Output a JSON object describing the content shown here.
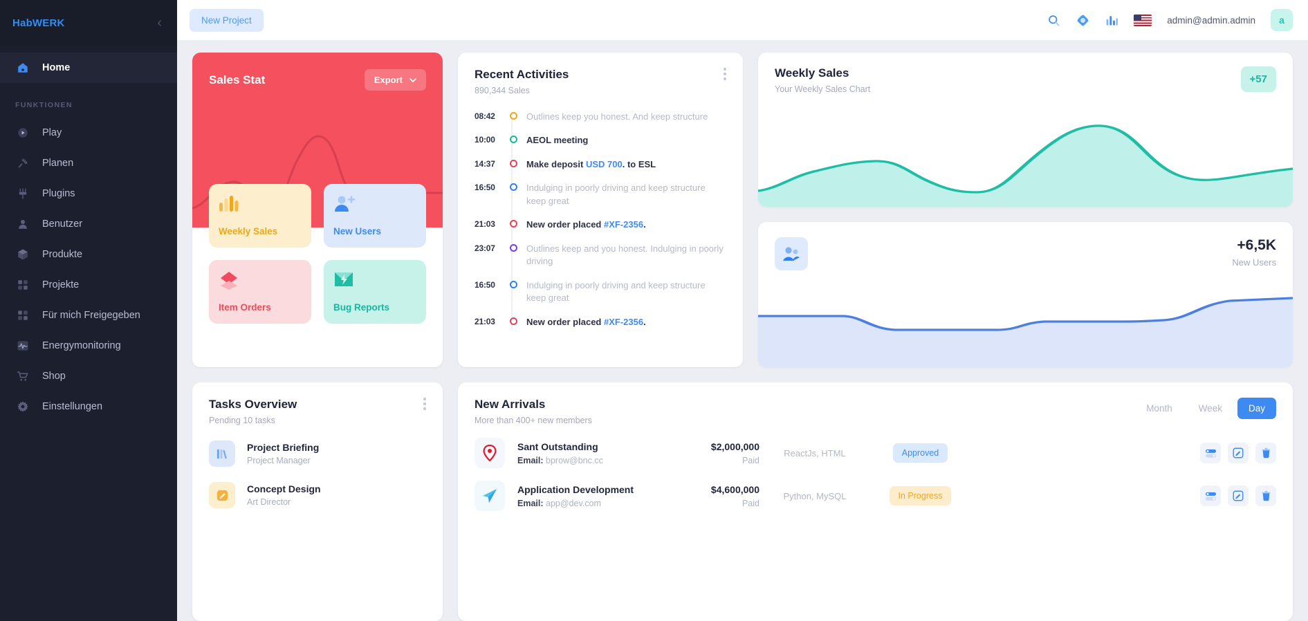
{
  "sidebar": {
    "logo": "HabWERK",
    "collapse_icon": "chevron-left-icon",
    "home": {
      "label": "Home",
      "icon": "home-icon"
    },
    "section_label": "FUNKTIONEN",
    "items": [
      {
        "label": "Play",
        "icon": "play-circle-icon"
      },
      {
        "label": "Planen",
        "icon": "tools-icon"
      },
      {
        "label": "Plugins",
        "icon": "plug-icon"
      },
      {
        "label": "Benutzer",
        "icon": "user-icon"
      },
      {
        "label": "Produkte",
        "icon": "box-icon"
      },
      {
        "label": "Projekte",
        "icon": "grid-icon"
      },
      {
        "label": "Für mich Freigegeben",
        "icon": "grid-icon"
      },
      {
        "label": "Energymonitoring",
        "icon": "pulse-icon"
      },
      {
        "label": "Shop",
        "icon": "cart-icon"
      },
      {
        "label": "Einstellungen",
        "icon": "gear-icon"
      }
    ]
  },
  "topbar": {
    "new_project": "New Project",
    "icons": [
      "search-icon",
      "diamond-icon",
      "bar-chart-icon",
      "flag-us-icon"
    ],
    "user_email": "admin@admin.admin",
    "avatar_letter": "a"
  },
  "sales_stat": {
    "title": "Sales Stat",
    "export_label": "Export",
    "export_icon": "chevron-down-icon",
    "tiles": [
      {
        "label": "Weekly Sales",
        "icon": "bar-chart-icon",
        "theme": "yellow"
      },
      {
        "label": "New Users",
        "icon": "user-plus-icon",
        "theme": "blue"
      },
      {
        "label": "Item Orders",
        "icon": "diamond-layers-icon",
        "theme": "pink"
      },
      {
        "label": "Bug Reports",
        "icon": "bug-mail-icon",
        "theme": "mint"
      }
    ]
  },
  "activities": {
    "title": "Recent Activities",
    "subtitle": "890,344 Sales",
    "menu_icon": "kebab-menu-icon",
    "items": [
      {
        "time": "08:42",
        "color": "#f0a718",
        "muted": true,
        "pre": "Outlines keep you honest. And keep structure",
        "hl": "",
        "post": ""
      },
      {
        "time": "10:00",
        "color": "#19b69e",
        "muted": false,
        "pre": "AEOL meeting",
        "hl": "",
        "post": ""
      },
      {
        "time": "14:37",
        "color": "#ee3d52",
        "muted": false,
        "pre": "Make deposit ",
        "hl": "USD 700",
        "post": ". to ESL"
      },
      {
        "time": "16:50",
        "color": "#2f80ed",
        "muted": true,
        "pre": "Indulging in poorly driving and keep structure keep great",
        "hl": "",
        "post": ""
      },
      {
        "time": "21:03",
        "color": "#ee3d52",
        "muted": false,
        "pre": "New order placed ",
        "hl": "#XF-2356",
        "post": "."
      },
      {
        "time": "23:07",
        "color": "#7c3aed",
        "muted": true,
        "pre": "Outlines keep and you honest. Indulging in poorly driving",
        "hl": "",
        "post": ""
      },
      {
        "time": "16:50",
        "color": "#2f80ed",
        "muted": true,
        "pre": "Indulging in poorly driving and keep structure keep great",
        "hl": "",
        "post": ""
      },
      {
        "time": "21:03",
        "color": "#ee3d52",
        "muted": false,
        "pre": "New order placed ",
        "hl": "#XF-2356",
        "post": "."
      }
    ]
  },
  "weekly_sales": {
    "title": "Weekly Sales",
    "subtitle": "Your Weekly Sales Chart",
    "badge": "+57"
  },
  "new_users": {
    "value": "+6,5K",
    "label": "New Users",
    "icon": "users-icon"
  },
  "tasks": {
    "title": "Tasks Overview",
    "subtitle": "Pending 10 tasks",
    "menu_icon": "kebab-menu-icon",
    "items": [
      {
        "name": "Project Briefing",
        "role": "Project Manager",
        "icon": "books-icon",
        "theme": "blue"
      },
      {
        "name": "Concept Design",
        "role": "Art Director",
        "icon": "pencil-square-icon",
        "theme": "yellow"
      }
    ]
  },
  "arrivals": {
    "title": "New Arrivals",
    "subtitle": "More than 400+ new members",
    "segments": [
      {
        "label": "Month",
        "active": false
      },
      {
        "label": "Week",
        "active": false
      },
      {
        "label": "Day",
        "active": true
      }
    ],
    "email_label": "Email:",
    "rows": [
      {
        "name": "Sant Outstanding",
        "email": "bprow@bnc.cc",
        "amount": "$2,000,000",
        "paid": "Paid",
        "tech": "ReactJs, HTML",
        "status": "Approved",
        "status_theme": "approved",
        "icon": "pin-p-icon",
        "icon_theme": "red",
        "actions": [
          "toggle-icon",
          "edit-icon",
          "delete-icon"
        ]
      },
      {
        "name": "Application Development",
        "email": "app@dev.com",
        "amount": "$4,600,000",
        "paid": "Paid",
        "tech": "Python, MySQL",
        "status": "In Progress",
        "status_theme": "progress",
        "icon": "send-plane-icon",
        "icon_theme": "cyan",
        "actions": [
          "toggle-icon",
          "edit-icon",
          "delete-icon"
        ]
      }
    ]
  },
  "chart_data": [
    {
      "type": "area",
      "title": "Sales Stat",
      "series": [
        {
          "name": "Sales",
          "values": [
            8,
            16,
            30,
            26,
            14,
            6,
            30,
            72,
            86,
            60,
            34,
            34,
            34
          ]
        }
      ],
      "x": [
        0,
        1,
        2,
        3,
        4,
        5,
        6,
        7,
        8,
        9,
        10,
        11,
        12
      ],
      "ylim": [
        0,
        100
      ],
      "grid": false,
      "legend": "none",
      "xlabel": "",
      "ylabel": ""
    },
    {
      "type": "area",
      "title": "Weekly Sales",
      "subtitle": "Your Weekly Sales Chart",
      "series": [
        {
          "name": "Weekly Sales",
          "values": [
            10,
            22,
            42,
            46,
            34,
            18,
            14,
            32,
            72,
            92,
            84,
            58,
            40,
            44
          ]
        }
      ],
      "x": [
        0,
        1,
        2,
        3,
        4,
        5,
        6,
        7,
        8,
        9,
        10,
        11,
        12,
        13
      ],
      "ylim": [
        0,
        100
      ],
      "grid": false,
      "legend": "none",
      "annotation": "+57"
    },
    {
      "type": "area",
      "title": "New Users",
      "series": [
        {
          "name": "New Users",
          "values": [
            52,
            52,
            50,
            40,
            38,
            38,
            40,
            44,
            46,
            46,
            48,
            62,
            72,
            74
          ]
        }
      ],
      "x": [
        0,
        1,
        2,
        3,
        4,
        5,
        6,
        7,
        8,
        9,
        10,
        11,
        12,
        13
      ],
      "ylim": [
        0,
        100
      ],
      "grid": false,
      "legend": "none",
      "annotation": "+6,5K"
    }
  ]
}
